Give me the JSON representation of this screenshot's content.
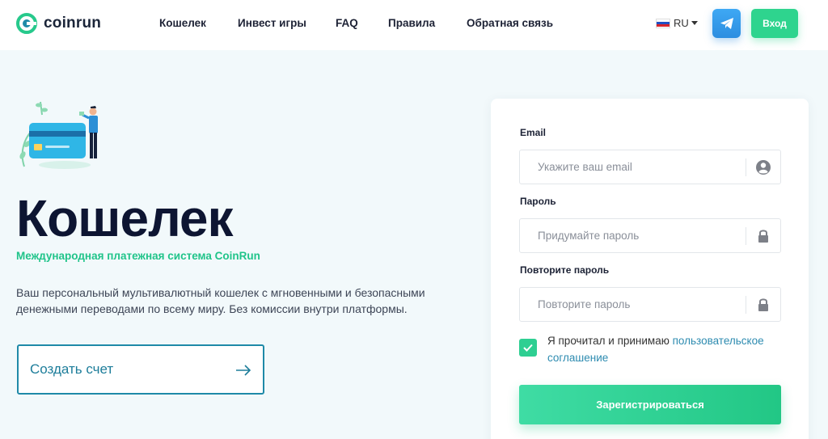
{
  "header": {
    "logo_text": "coinrun",
    "nav": [
      "Кошелек",
      "Инвест игры",
      "FAQ",
      "Правила",
      "Обратная связь"
    ],
    "lang": "RU",
    "login_label": "Вход"
  },
  "hero": {
    "title": "Кошелек",
    "subtitle": "Международная платежная система CoinRun",
    "description": "Ваш персональный мультивалютный кошелек с мгновенными и безопасными денежными переводами по всему миру. Без комиссии внутри платформы.",
    "create_label": "Создать счет"
  },
  "form": {
    "email_label": "Email",
    "email_placeholder": "Укажите ваш email",
    "password_label": "Пароль",
    "password_placeholder": "Придумайте пароль",
    "repeat_label": "Повторите пароль",
    "repeat_placeholder": "Повторите пароль",
    "agree_text": "Я прочитал и принимаю ",
    "agree_link": "пользовательское соглашение",
    "agree_checked": true,
    "submit_label": "Зарегистрироваться"
  },
  "colors": {
    "accent_green": "#2ed48e",
    "accent_teal": "#1f8aa8",
    "telegram_blue": "#2d8ee0",
    "background": "#f2f9fb"
  }
}
